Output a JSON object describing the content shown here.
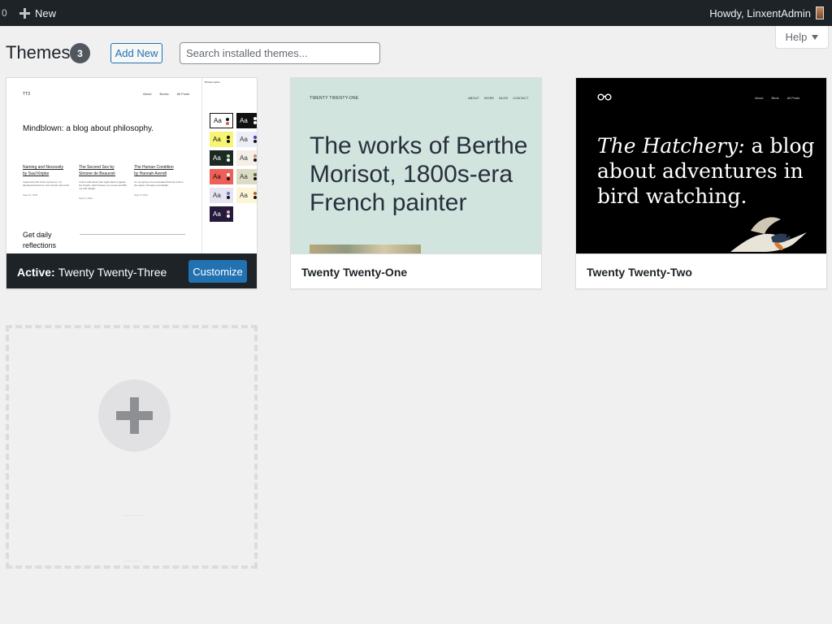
{
  "adminbar": {
    "count": "0",
    "new_label": "New",
    "howdy": "Howdy, LinxentAdmin"
  },
  "help": {
    "label": "Help"
  },
  "header": {
    "title": "Themes",
    "count": "3",
    "add_new_label": "Add New",
    "search_placeholder": "Search installed themes..."
  },
  "themes": [
    {
      "name": "Twenty Twenty-Three",
      "active_prefix": "Active:",
      "customize_label": "Customize",
      "preview": {
        "site_title": "TT3",
        "nav": [
          "About",
          "Books",
          "All Posts"
        ],
        "headline": "Mindblown: a blog about philosophy.",
        "posts": [
          {
            "title_1": "Naming and Necessity",
            "title_2": "by Saul Kripke",
            "excerpt": "Inspired by this wind of pronoun, my daydreams become more fervent and vivid.",
            "date": "Sept 12, 2021"
          },
          {
            "title_1": "The Second Sex by",
            "title_2": "Simone de Beauvoir",
            "excerpt": "I had a wild dream last night about a jaguar, his cheeks, which leaves my nerves and fills me with delight.",
            "date": "Sept 8, 2021"
          },
          {
            "title_1": "The Human Condition",
            "title_2": "by Hannah Arendt",
            "excerpt": "I'm not going to be persuaded that the road to the region of beauty and delight.",
            "date": "Sept 5, 2021"
          }
        ],
        "daily_1": "Get daily",
        "daily_2": "reflections",
        "panel_title": "Browse styles",
        "swatch_label": "Aa"
      }
    },
    {
      "name": "Twenty Twenty-One",
      "preview": {
        "site_title": "TWENTY TWENTY-ONE",
        "nav": [
          "ABOUT",
          "WORK",
          "BLOG",
          "CONTACT"
        ],
        "headline": "The works of Berthe Morisot, 1800s-era French painter"
      }
    },
    {
      "name": "Twenty Twenty-Two",
      "preview": {
        "nav": [
          "About",
          "Birds",
          "All Posts"
        ],
        "headline_italic": "The Hatchery:",
        "headline_rest": " a blog about adventures in bird watching."
      }
    }
  ],
  "colors": {
    "accent": "#2271b1",
    "adminbar": "#1d2327",
    "tt1_bg": "#d1e4dd"
  }
}
